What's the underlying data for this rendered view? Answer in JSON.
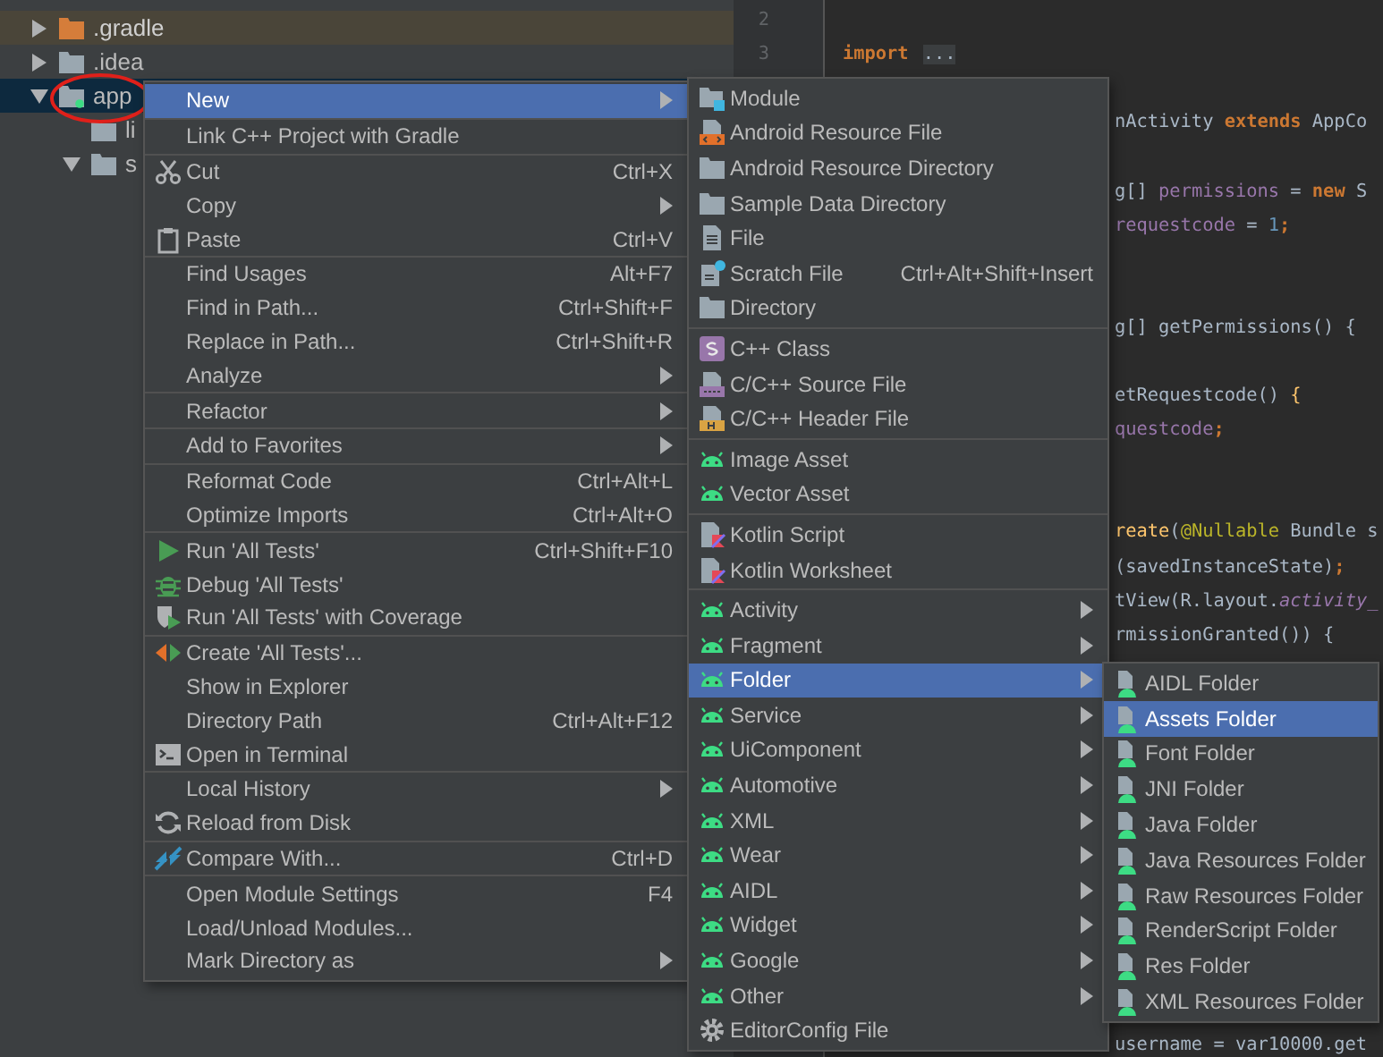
{
  "project_tree": {
    "items": [
      {
        "label": ".gradle",
        "kind": "folder",
        "ignored": true,
        "expanded": false,
        "selected": false
      },
      {
        "label": ".idea",
        "kind": "folder",
        "ignored": false,
        "expanded": false,
        "selected": false
      },
      {
        "label": "app",
        "kind": "module",
        "ignored": false,
        "expanded": true,
        "selected": true,
        "children": [
          {
            "label": "li",
            "kind": "leaf",
            "ignored": false,
            "selected": false
          },
          {
            "label": "s",
            "kind": "folder",
            "ignored": false,
            "expanded": true,
            "selected": false
          }
        ]
      }
    ]
  },
  "annotation": {
    "kind": "circle",
    "color": "#e0201a"
  },
  "editor": {
    "lines": [
      {
        "number": "2",
        "kind": "blank"
      },
      {
        "number": "3",
        "kind": "full",
        "tokens": [
          {
            "text": "import",
            "kind": "keyword"
          },
          {
            "text": "...",
            "kind": "fold"
          }
        ]
      },
      {
        "kind": "blank"
      },
      {
        "kind": "fragment",
        "tokens": [
          {
            "text": "nActivity ",
            "kind": "plain"
          },
          {
            "text": "extends",
            "kind": "keyword"
          },
          {
            "text": " AppCo",
            "kind": "plain"
          }
        ]
      },
      {
        "kind": "blank"
      },
      {
        "kind": "fragment",
        "tokens": [
          {
            "text": "g[] ",
            "kind": "plain"
          },
          {
            "text": "permissions",
            "kind": "field"
          },
          {
            "text": " = ",
            "kind": "plain"
          },
          {
            "text": "new",
            "kind": "keyword"
          },
          {
            "text": " S",
            "kind": "plain"
          }
        ]
      },
      {
        "kind": "fragment",
        "tokens": [
          {
            "text": "requestcode",
            "kind": "field"
          },
          {
            "text": " = ",
            "kind": "plain"
          },
          {
            "text": "1",
            "kind": "number"
          },
          {
            "text": ";",
            "kind": "keyword"
          }
        ]
      },
      {
        "kind": "blank"
      },
      {
        "kind": "blank"
      },
      {
        "kind": "fragment",
        "tokens": [
          {
            "text": "g[] getPermissions() {",
            "kind": "plain"
          }
        ]
      },
      {
        "kind": "blank"
      },
      {
        "kind": "fragment",
        "tokens": [
          {
            "text": "etRequestcode",
            "kind": "plain"
          },
          {
            "text": "() ",
            "kind": "plain"
          },
          {
            "text": "{",
            "kind": "method"
          }
        ]
      },
      {
        "kind": "fragment",
        "tokens": [
          {
            "text": "questcode",
            "kind": "field"
          },
          {
            "text": ";",
            "kind": "keyword"
          }
        ]
      },
      {
        "kind": "blank"
      },
      {
        "kind": "blank"
      },
      {
        "kind": "fragment",
        "tokens": [
          {
            "text": "reate",
            "kind": "method"
          },
          {
            "text": "(",
            "kind": "plain"
          },
          {
            "text": "@Nullable",
            "kind": "annotation"
          },
          {
            "text": " Bundle s",
            "kind": "plain"
          }
        ]
      },
      {
        "kind": "fragment",
        "tokens": [
          {
            "text": "(savedInstanceState)",
            "kind": "plain"
          },
          {
            "text": ";",
            "kind": "keyword"
          }
        ]
      },
      {
        "kind": "fragment",
        "tokens": [
          {
            "text": "tView(R.layout.",
            "kind": "plain"
          },
          {
            "text": "activity_",
            "kind": "italic"
          }
        ]
      },
      {
        "kind": "fragment",
        "tokens": [
          {
            "text": "rmissionGranted()) {",
            "kind": "plain"
          }
        ]
      },
      {
        "kind": "blank"
      },
      {
        "kind": "blank"
      },
      {
        "kind": "blank"
      },
      {
        "kind": "blank"
      },
      {
        "kind": "blank"
      },
      {
        "kind": "blank"
      },
      {
        "kind": "blank"
      },
      {
        "kind": "blank"
      },
      {
        "kind": "blank"
      },
      {
        "kind": "blank"
      },
      {
        "kind": "blank"
      },
      {
        "kind": "fragment",
        "tokens": [
          {
            "text": "username = var10000.get",
            "kind": "plain"
          }
        ]
      }
    ]
  },
  "context_menu": {
    "groups": [
      [
        {
          "label": "New",
          "selected": true,
          "submenu": true
        }
      ],
      [
        {
          "label": "Link C++ Project with Gradle",
          "selected": false,
          "submenu": false
        }
      ],
      [
        {
          "label": "Cut",
          "shortcut": "Ctrl+X",
          "selected": false,
          "submenu": false
        },
        {
          "label": "Copy",
          "selected": false,
          "submenu": true
        },
        {
          "label": "Paste",
          "shortcut": "Ctrl+V",
          "selected": false,
          "submenu": false
        }
      ],
      [
        {
          "label": "Find Usages",
          "shortcut": "Alt+F7",
          "selected": false,
          "submenu": false
        },
        {
          "label": "Find in Path...",
          "shortcut": "Ctrl+Shift+F",
          "selected": false,
          "submenu": false
        },
        {
          "label": "Replace in Path...",
          "shortcut": "Ctrl+Shift+R",
          "selected": false,
          "submenu": false
        },
        {
          "label": "Analyze",
          "selected": false,
          "submenu": true
        }
      ],
      [
        {
          "label": "Refactor",
          "selected": false,
          "submenu": true
        }
      ],
      [
        {
          "label": "Add to Favorites",
          "selected": false,
          "submenu": true
        }
      ],
      [
        {
          "label": "Reformat Code",
          "shortcut": "Ctrl+Alt+L",
          "selected": false,
          "submenu": false
        },
        {
          "label": "Optimize Imports",
          "shortcut": "Ctrl+Alt+O",
          "selected": false,
          "submenu": false
        }
      ],
      [
        {
          "label": "Run 'All Tests'",
          "shortcut": "Ctrl+Shift+F10",
          "selected": false,
          "submenu": false
        },
        {
          "label": "Debug 'All Tests'",
          "selected": false,
          "submenu": false
        },
        {
          "label": "Run 'All Tests' with Coverage",
          "selected": false,
          "submenu": false
        }
      ],
      [
        {
          "label": "Create 'All Tests'...",
          "selected": false,
          "submenu": false
        },
        {
          "label": "Show in Explorer",
          "selected": false,
          "submenu": false
        },
        {
          "label": "Directory Path",
          "shortcut": "Ctrl+Alt+F12",
          "selected": false,
          "submenu": false
        },
        {
          "label": "Open in Terminal",
          "selected": false,
          "submenu": false
        }
      ],
      [
        {
          "label": "Local History",
          "selected": false,
          "submenu": true
        },
        {
          "label": "Reload from Disk",
          "selected": false,
          "submenu": false
        }
      ],
      [
        {
          "label": "Compare With...",
          "shortcut": "Ctrl+D",
          "selected": false,
          "submenu": false
        }
      ],
      [
        {
          "label": "Open Module Settings",
          "shortcut": "F4",
          "selected": false,
          "submenu": false
        },
        {
          "label": "Load/Unload Modules...",
          "selected": false,
          "submenu": false
        },
        {
          "label": "Mark Directory as",
          "selected": false,
          "submenu": true
        }
      ]
    ]
  },
  "new_submenu": {
    "groups": [
      [
        {
          "label": "Module",
          "selected": false,
          "submenu": false
        },
        {
          "label": "Android Resource File",
          "selected": false,
          "submenu": false
        },
        {
          "label": "Android Resource Directory",
          "selected": false,
          "submenu": false
        },
        {
          "label": "Sample Data Directory",
          "selected": false,
          "submenu": false
        },
        {
          "label": "File",
          "selected": false,
          "submenu": false
        },
        {
          "label": "Scratch File",
          "shortcut": "Ctrl+Alt+Shift+Insert",
          "selected": false,
          "submenu": false
        },
        {
          "label": "Directory",
          "selected": false,
          "submenu": false
        }
      ],
      [
        {
          "label": "C++ Class",
          "selected": false,
          "submenu": false
        },
        {
          "label": "C/C++ Source File",
          "selected": false,
          "submenu": false
        },
        {
          "label": "C/C++ Header File",
          "selected": false,
          "submenu": false
        }
      ],
      [
        {
          "label": "Image Asset",
          "selected": false,
          "submenu": false
        },
        {
          "label": "Vector Asset",
          "selected": false,
          "submenu": false
        }
      ],
      [
        {
          "label": "Kotlin Script",
          "selected": false,
          "submenu": false
        },
        {
          "label": "Kotlin Worksheet",
          "selected": false,
          "submenu": false
        }
      ],
      [
        {
          "label": "Activity",
          "selected": false,
          "submenu": true
        },
        {
          "label": "Fragment",
          "selected": false,
          "submenu": true
        },
        {
          "label": "Folder",
          "selected": true,
          "submenu": true
        },
        {
          "label": "Service",
          "selected": false,
          "submenu": true
        },
        {
          "label": "UiComponent",
          "selected": false,
          "submenu": true
        },
        {
          "label": "Automotive",
          "selected": false,
          "submenu": true
        },
        {
          "label": "XML",
          "selected": false,
          "submenu": true
        },
        {
          "label": "Wear",
          "selected": false,
          "submenu": true
        },
        {
          "label": "AIDL",
          "selected": false,
          "submenu": true
        },
        {
          "label": "Widget",
          "selected": false,
          "submenu": true
        },
        {
          "label": "Google",
          "selected": false,
          "submenu": true
        },
        {
          "label": "Other",
          "selected": false,
          "submenu": true
        },
        {
          "label": "EditorConfig File",
          "selected": false,
          "submenu": false
        }
      ]
    ]
  },
  "folder_submenu": {
    "groups": [
      [
        {
          "label": "AIDL Folder",
          "selected": false
        },
        {
          "label": "Assets Folder",
          "selected": true
        },
        {
          "label": "Font Folder",
          "selected": false
        },
        {
          "label": "JNI Folder",
          "selected": false
        },
        {
          "label": "Java Folder",
          "selected": false
        },
        {
          "label": "Java Resources Folder",
          "selected": false
        },
        {
          "label": "Raw Resources Folder",
          "selected": false
        },
        {
          "label": "RenderScript Folder",
          "selected": false
        },
        {
          "label": "Res Folder",
          "selected": false
        },
        {
          "label": "XML Resources Folder",
          "selected": false
        }
      ]
    ]
  }
}
